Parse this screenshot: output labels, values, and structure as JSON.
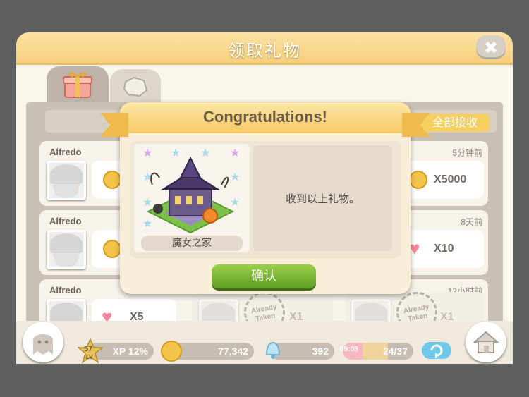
{
  "window": {
    "title": "领取礼物",
    "close_label": "✖"
  },
  "tabs": [
    {
      "icon": "gift-icon"
    },
    {
      "icon": "stone-icon"
    }
  ],
  "claim_all_label": "全部接收",
  "rows": [
    {
      "sender": "Alfredo",
      "time": "5分钟前",
      "reward": "X5000",
      "reward_icon": "coin-icon"
    },
    {
      "sender": "Alfredo",
      "time": "8天前",
      "reward": "X10",
      "reward_icon": "heart-icon"
    },
    {
      "sender": "Alfredo",
      "time": "12小时前",
      "rewards": [
        {
          "reward": "X5",
          "reward_icon": "heart-icon"
        },
        {
          "reward": "X1",
          "stamp": "Already Taken"
        },
        {
          "reward": "X1",
          "stamp": "Already Taken"
        }
      ]
    }
  ],
  "dialog": {
    "title": "Congratulations!",
    "gift_name": "魔女之家",
    "message": "收到以上礼物。",
    "confirm_label": "确认"
  },
  "status_bar": {
    "level": "57",
    "level_label": "LV",
    "xp": "XP 12%",
    "coins": "77,342",
    "bells": "392",
    "hearts_timer": "09:08",
    "hearts": "24/37"
  },
  "colors": {
    "accent": "#f5c865",
    "confirm": "#6aac29",
    "background": "#5d605e"
  }
}
